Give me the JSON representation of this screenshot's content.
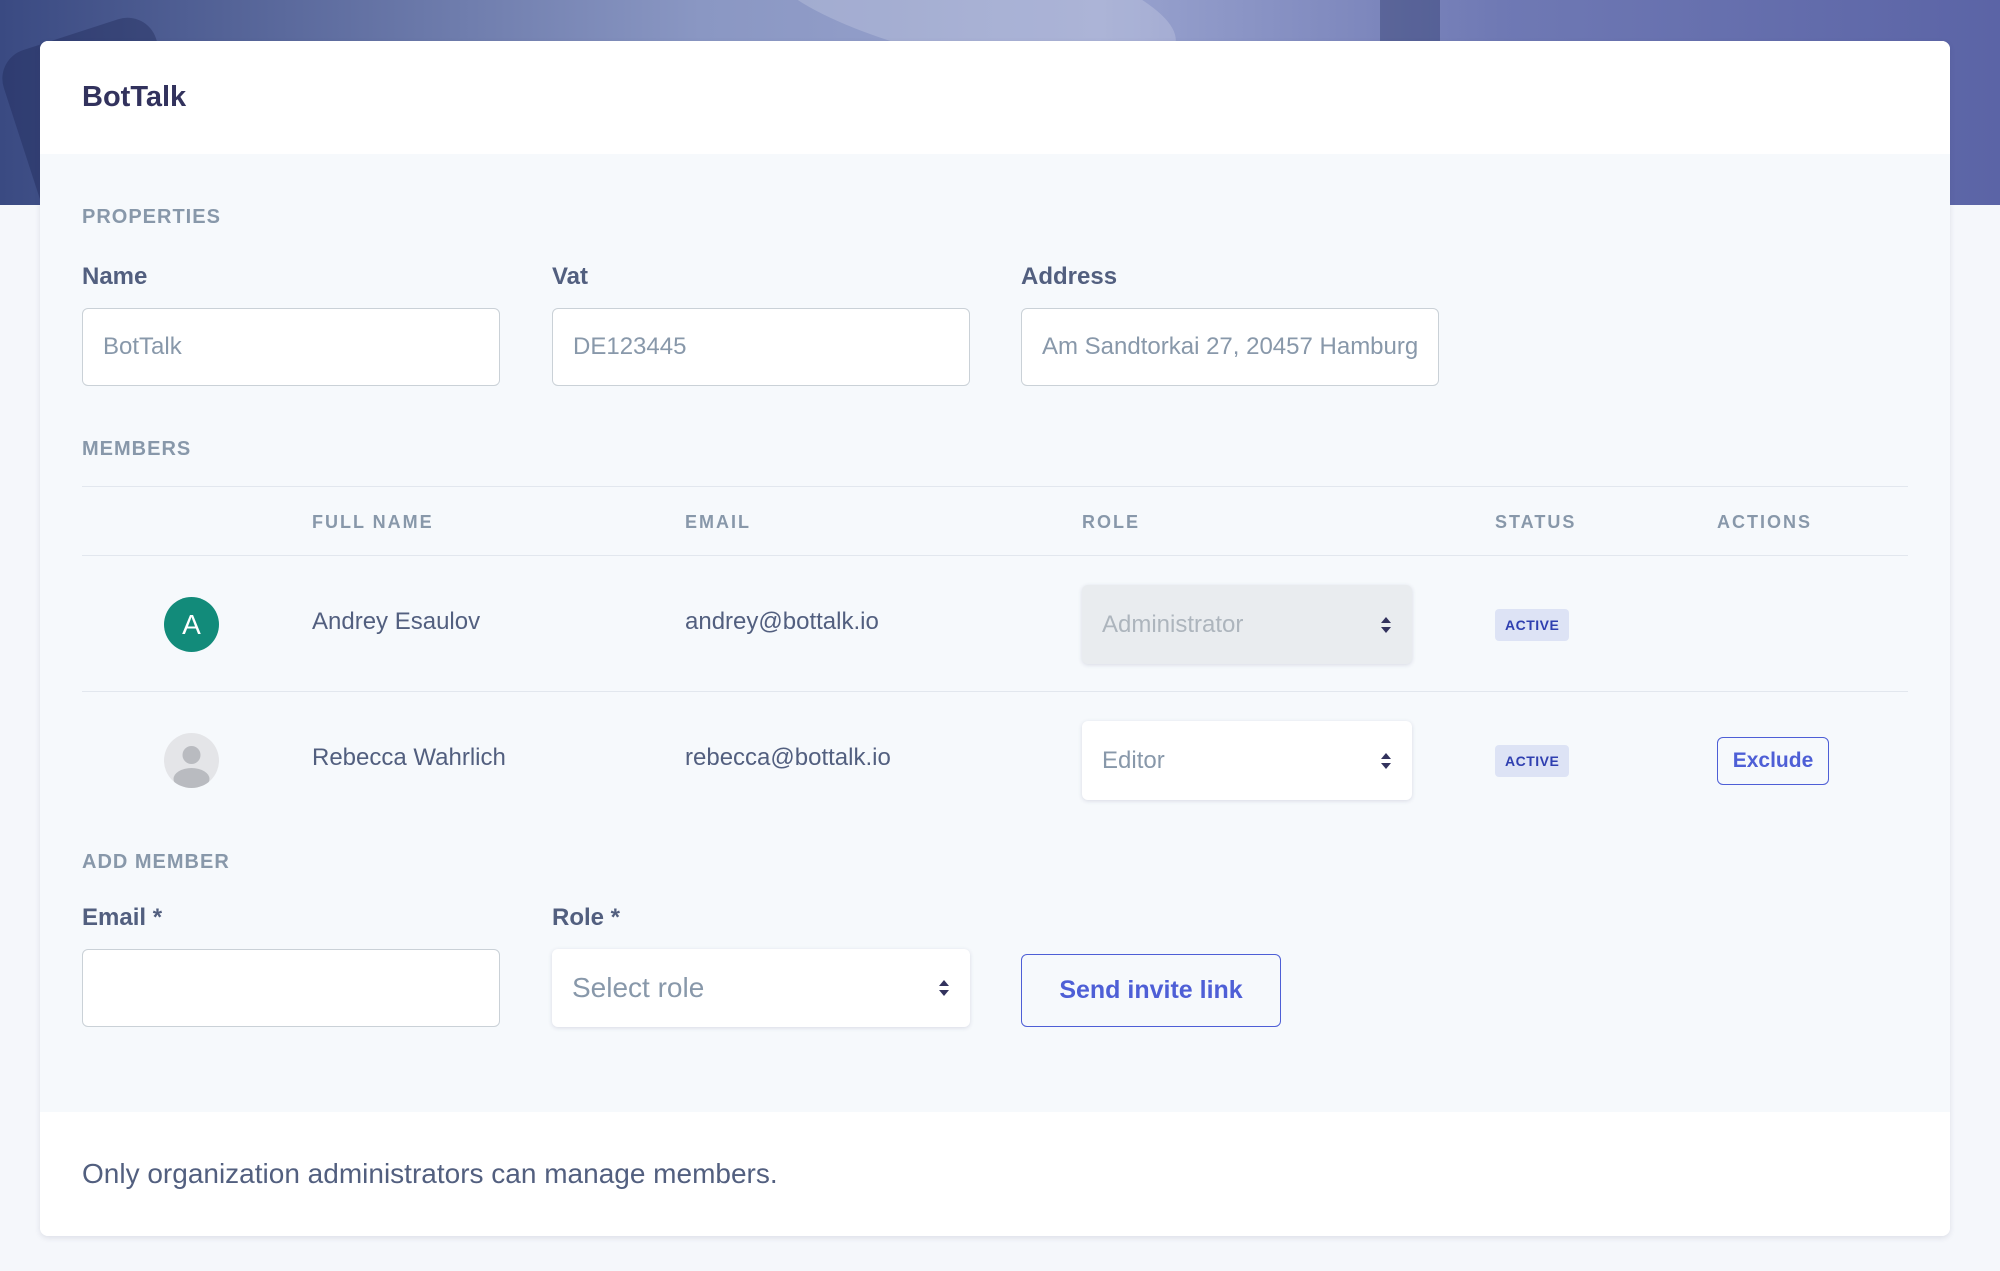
{
  "organization": {
    "title": "BotTalk"
  },
  "properties": {
    "section_label": "PROPERTIES",
    "name_label": "Name",
    "name_value": "BotTalk",
    "vat_label": "Vat",
    "vat_value": "DE123445",
    "address_label": "Address",
    "address_value": "Am Sandtorkai 27, 20457 Hamburg"
  },
  "members": {
    "section_label": "MEMBERS",
    "columns": [
      "FULL NAME",
      "EMAIL",
      "ROLE",
      "STATUS",
      "ACTIONS"
    ],
    "rows": [
      {
        "avatar_initial": "A",
        "avatar_color": "#128b7a",
        "full_name": "Andrey Esaulov",
        "email": "andrey@bottalk.io",
        "role": "Administrator",
        "role_disabled": true,
        "status": "ACTIVE",
        "action": ""
      },
      {
        "avatar_initial": "",
        "avatar_icon": "user-placeholder-icon",
        "full_name": "Rebecca Wahrlich",
        "email": "rebecca@bottalk.io",
        "role": "Editor",
        "role_disabled": false,
        "status": "ACTIVE",
        "action": "Exclude"
      }
    ]
  },
  "add_member": {
    "section_label": "ADD MEMBER",
    "email_label": "Email *",
    "email_value": "",
    "role_label": "Role *",
    "role_placeholder": "Select role",
    "send_button": "Send invite link"
  },
  "footer": {
    "note": "Only organization administrators can manage members."
  },
  "colors": {
    "accent": "#4e5fd6",
    "badge_bg": "#dde3f5",
    "badge_text": "#2f3fb0"
  }
}
